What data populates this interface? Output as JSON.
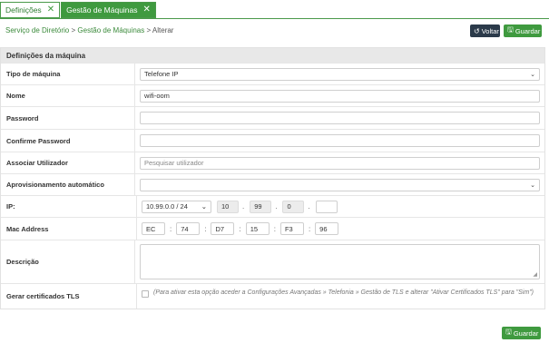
{
  "tabs": [
    {
      "label": "Definições",
      "active": false
    },
    {
      "label": "Gestão de Máquinas",
      "active": true
    }
  ],
  "breadcrumb": {
    "items": [
      "Serviço de Diretório",
      "Gestão de Máquinas"
    ],
    "separator": ">",
    "current": "Alterar"
  },
  "toolbar": {
    "back_label": "Voltar",
    "save_label": "Guardar"
  },
  "section": {
    "title": "Definições da máquina"
  },
  "form": {
    "tipo": {
      "label": "Tipo de máquina",
      "value": "Telefone IP"
    },
    "nome": {
      "label": "Nome",
      "value": "wifi-oom"
    },
    "password": {
      "label": "Password",
      "value": ""
    },
    "confirm": {
      "label": "Confirme Password",
      "value": ""
    },
    "assoc": {
      "label": "Associar Utilizador",
      "placeholder": "Pesquisar utilizador"
    },
    "aprov": {
      "label": "Aprovisionamento automático",
      "value": ""
    },
    "ip": {
      "label": "IP:",
      "subnet": "10.99.0.0 / 24",
      "octets": [
        "10",
        "99",
        "0",
        ""
      ]
    },
    "mac": {
      "label": "Mac Address",
      "octets": [
        "EC",
        "74",
        "D7",
        "15",
        "F3",
        "96"
      ]
    },
    "descricao": {
      "label": "Descrição",
      "value": ""
    },
    "tls": {
      "label": "Gerar certificados TLS",
      "checked": false,
      "note": "(Para ativar esta opção aceder a Configurações Avançadas » Telefonia » Gestão de TLS e alterar \"Ativar Certificados TLS\" para \"Sim\")"
    }
  },
  "footer": {
    "save_label": "Guardar"
  },
  "colors": {
    "accent": "#3f9a3f",
    "dark_button": "#2b3a4a",
    "panel_header": "#e8e8e8"
  },
  "icons": {
    "close": "close-icon",
    "back": "undo-icon",
    "save": "floppy-disk-icon",
    "dropdown": "chevron-down-icon"
  }
}
